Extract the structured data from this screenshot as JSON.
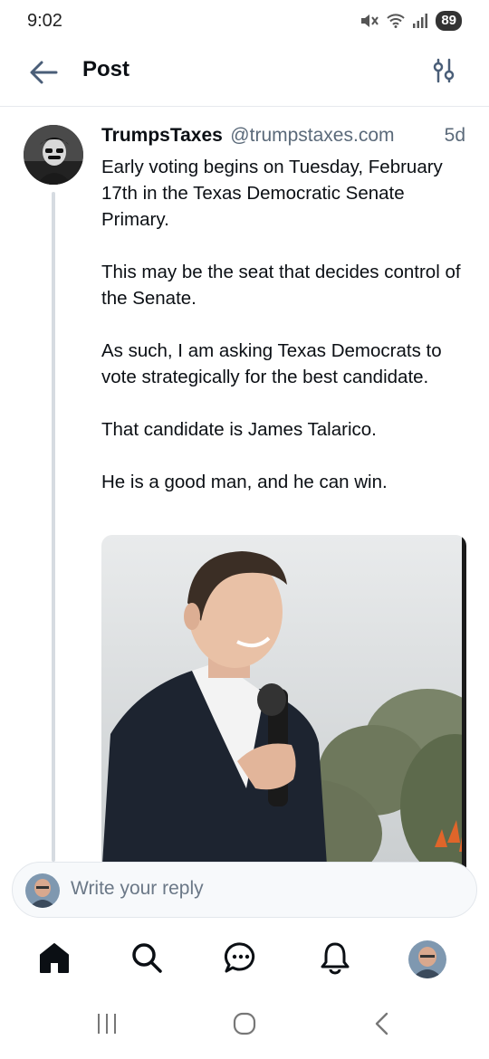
{
  "status_bar": {
    "time": "9:02",
    "battery": "89",
    "icons": [
      "mute-icon",
      "wifi-icon",
      "signal-icon"
    ]
  },
  "header": {
    "title": "Post",
    "back_icon": "arrow-left-icon",
    "filter_icon": "sliders-icon"
  },
  "post": {
    "author_name": "TrumpsTaxes",
    "author_handle": "@trumpstaxes.com",
    "age": "5d",
    "paragraphs": [
      "Early voting begins on Tuesday, February 17th in the Texas Democratic Senate Primary.",
      "This may be the seat that decides control of the Senate.",
      "As such, I am asking Texas Democrats to vote strategically for the best candidate.",
      "That candidate is James Talarico.",
      "He is a good man, and he can win."
    ]
  },
  "reply": {
    "placeholder": "Write your reply"
  },
  "tabbar": {
    "items": [
      "home-icon",
      "search-icon",
      "chat-icon",
      "bell-icon",
      "profile-avatar"
    ]
  },
  "system_nav": {
    "items": [
      "recents-icon",
      "home-circle-icon",
      "back-chevron-icon"
    ]
  },
  "colors": {
    "text": "#0b0f14",
    "muted": "#5b6a7a",
    "accent": "#4a5e78",
    "thread_line": "#d6dbe1"
  }
}
